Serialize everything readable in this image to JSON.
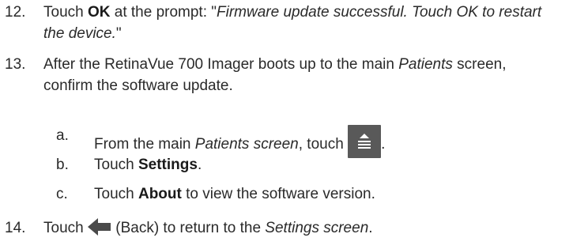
{
  "steps": [
    {
      "num": "12.",
      "line1": {
        "a": "Touch ",
        "b": "OK",
        "c": " at the prompt: \"",
        "d": "Firmware update successful. Touch OK to restart"
      },
      "line2": {
        "a": "the device.",
        "b": "\""
      }
    },
    {
      "num": "13.",
      "line1": {
        "a": "After the RetinaVue 700 Imager boots up to the main ",
        "b": "Patients",
        "c": " screen,"
      },
      "line2": "confirm the software update."
    },
    {
      "num": "14.",
      "a": "Touch ",
      "icon": "back-arrow-icon",
      "b": " (Back) to return to the ",
      "c": "Settings screen",
      "d": "."
    }
  ],
  "substeps": [
    {
      "letter": "a.",
      "a": "From the main ",
      "b": "Patients screen",
      "c": ", touch ",
      "icon": "menu-eject-icon",
      "d": "."
    },
    {
      "letter": "b.",
      "a": "Touch ",
      "b": "Settings",
      "c": "."
    },
    {
      "letter": "c.",
      "a": "Touch ",
      "b": "About",
      "c": " to view the software version."
    }
  ],
  "colors": {
    "text": "#2a2a2a",
    "icon_bg": "#595959",
    "icon_fg": "#ffffff",
    "arrow": "#4a4a4a"
  }
}
